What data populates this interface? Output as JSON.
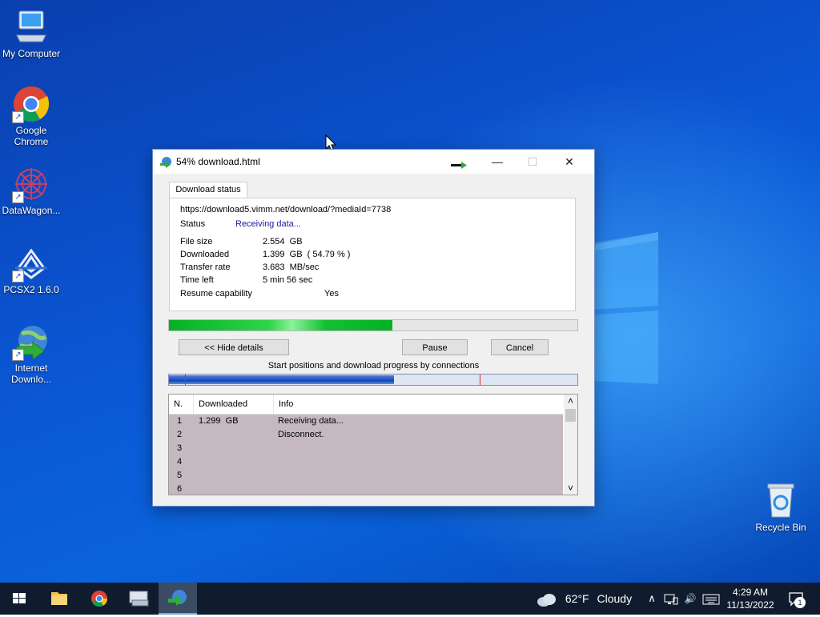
{
  "desktop": {
    "icons": [
      {
        "label": "My Computer"
      },
      {
        "label": "Google Chrome"
      },
      {
        "label": "DataWagon..."
      },
      {
        "label": "PCSX2 1.6.0"
      },
      {
        "label": "Internet Downlo..."
      },
      {
        "label": "Recycle Bin"
      }
    ],
    "shortcut_glyph": "↗"
  },
  "window": {
    "title": "54% download.html",
    "minimize_glyph": "—",
    "maximize_glyph": "☐",
    "close_glyph": "✕",
    "tab_label": "Download status",
    "url": "https://download5.vimm.net/download/?mediaId=7738",
    "status_label": "Status",
    "status_value": "Receiving data...",
    "file_size_label": "File size",
    "file_size_value": "2.554  GB",
    "downloaded_label": "Downloaded",
    "downloaded_value": "1.399  GB  ( 54.79 % )",
    "transfer_rate_label": "Transfer rate",
    "transfer_rate_value": "3.683  MB/sec",
    "time_left_label": "Time left",
    "time_left_value": "5 min 56 sec",
    "resume_label": "Resume capability",
    "resume_value": "Yes",
    "progress_fraction": 0.5479,
    "hide_details_label": "<< Hide details",
    "pause_label": "Pause",
    "cancel_label": "Cancel",
    "connections_caption": "Start positions and download progress by connections",
    "connections_progress_fraction": 0.55,
    "connection_markers_fraction": [
      0.04,
      0.76
    ],
    "columns": {
      "n": "N.",
      "downloaded": "Downloaded",
      "info": "Info"
    },
    "rows": [
      {
        "n": "1",
        "downloaded": "1.299  GB",
        "info": "Receiving data..."
      },
      {
        "n": "2",
        "downloaded": "",
        "info": "Disconnect."
      },
      {
        "n": "3",
        "downloaded": "",
        "info": ""
      },
      {
        "n": "4",
        "downloaded": "",
        "info": ""
      },
      {
        "n": "5",
        "downloaded": "",
        "info": ""
      },
      {
        "n": "6",
        "downloaded": "",
        "info": ""
      }
    ],
    "scroll_up_glyph": "˄",
    "scroll_down_glyph": "˅"
  },
  "taskbar": {
    "weather_temp": "62°F",
    "weather_text": "Cloudy",
    "chevron_glyph": "∧",
    "volume_glyph": "🔊",
    "time": "4:29 AM",
    "date": "11/13/2022",
    "notification_count": "1"
  },
  "colors": {
    "accent": "#0b56d4",
    "progress_green": "#06b025",
    "status_blue": "#1a1aa6",
    "taskbar": "#101c2e"
  }
}
